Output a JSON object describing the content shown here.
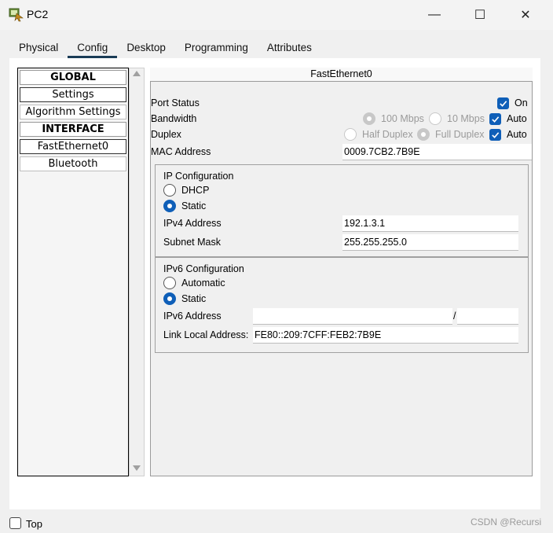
{
  "window": {
    "title": "PC2",
    "minimize_glyph": "—",
    "maximize_glyph": "☐",
    "close_glyph": "✕"
  },
  "tabs": [
    "Physical",
    "Config",
    "Desktop",
    "Programming",
    "Attributes"
  ],
  "active_tab": "Config",
  "sidebar": {
    "items": [
      {
        "label": "GLOBAL",
        "type": "header"
      },
      {
        "label": "Settings",
        "type": "item"
      },
      {
        "label": "Algorithm Settings",
        "type": "item"
      },
      {
        "label": "INTERFACE",
        "type": "header"
      },
      {
        "label": "FastEthernet0",
        "type": "item",
        "selected": true
      },
      {
        "label": "Bluetooth",
        "type": "item"
      }
    ]
  },
  "interface": {
    "title": "FastEthernet0",
    "port_status": {
      "label": "Port Status",
      "on_label": "On",
      "checked": true
    },
    "bandwidth": {
      "label": "Bandwidth",
      "opt1": "100 Mbps",
      "opt2": "10 Mbps",
      "auto_label": "Auto",
      "auto_checked": true
    },
    "duplex": {
      "label": "Duplex",
      "opt1": "Half Duplex",
      "opt2": "Full Duplex",
      "auto_label": "Auto",
      "auto_checked": true
    },
    "mac": {
      "label": "MAC Address",
      "value": "0009.7CB2.7B9E"
    }
  },
  "ipv4": {
    "title": "IP Configuration",
    "dhcp_label": "DHCP",
    "static_label": "Static",
    "selected": "Static",
    "address_label": "IPv4 Address",
    "address_value": "192.1.3.1",
    "mask_label": "Subnet Mask",
    "mask_value": "255.255.255.0"
  },
  "ipv6": {
    "title": "IPv6 Configuration",
    "auto_label": "Automatic",
    "static_label": "Static",
    "selected": "Static",
    "address_label": "IPv6 Address",
    "address_value": "",
    "prefix_sep": "/",
    "prefix_value": "",
    "link_local_label": "Link Local Address:",
    "link_local_value": "FE80::209:7CFF:FEB2:7B9E"
  },
  "footer": {
    "top_label": "Top",
    "top_checked": false,
    "watermark": "CSDN @Recursi"
  },
  "colors": {
    "accent": "#0f5fb8",
    "tab_underline": "#1a3c56"
  }
}
